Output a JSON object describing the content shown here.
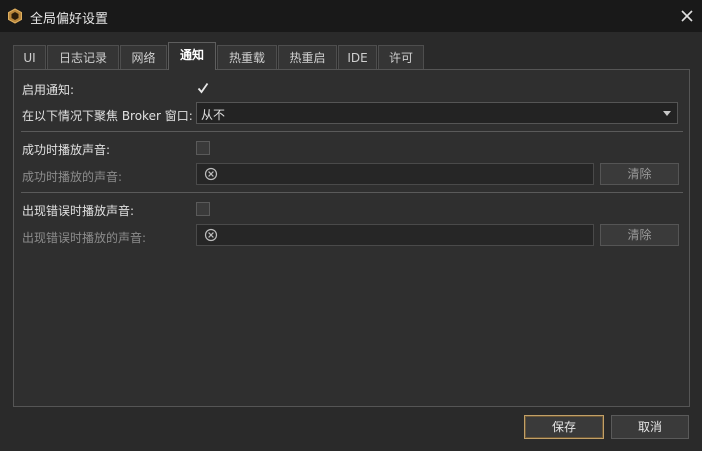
{
  "window": {
    "title": "全局偏好设置",
    "app_icon": "unreal-broker-icon",
    "close_icon": "close-icon"
  },
  "tabs": [
    {
      "label": "UI",
      "active": false
    },
    {
      "label": "日志记录",
      "active": false
    },
    {
      "label": "网络",
      "active": false
    },
    {
      "label": "通知",
      "active": true
    },
    {
      "label": "热重载",
      "active": false
    },
    {
      "label": "热重启",
      "active": false
    },
    {
      "label": "IDE",
      "active": false
    },
    {
      "label": "许可",
      "active": false
    }
  ],
  "notifications": {
    "enable_label": "启用通知:",
    "enable_checked": true,
    "focus_label": "在以下情况下聚焦 Broker 窗口:",
    "focus_value": "从不",
    "success_sound_label": "成功时播放声音:",
    "success_sound_checked": false,
    "success_file_label": "成功时播放的声音:",
    "success_file_value": "",
    "success_clear_label": "清除",
    "error_sound_label": "出现错误时播放声音:",
    "error_sound_checked": false,
    "error_file_label": "出现错误时播放的声音:",
    "error_file_value": "",
    "error_clear_label": "清除"
  },
  "footer": {
    "save_label": "保存",
    "cancel_label": "取消"
  },
  "colors": {
    "accent": "#c2a067",
    "background": "#2a2a2a",
    "titlebar": "#191919"
  }
}
